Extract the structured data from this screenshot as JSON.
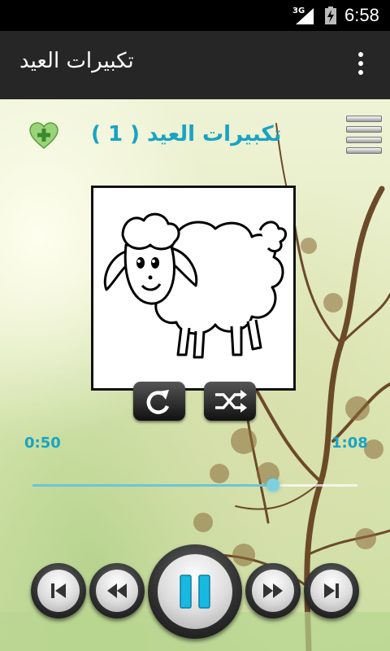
{
  "status_bar": {
    "network": "3G",
    "time": "6:58"
  },
  "action_bar": {
    "title": "تكبيرات العيد",
    "overflow_icon": "more-vert-icon"
  },
  "player": {
    "track_title": "تكبيرات العيد ( 1 )",
    "time_elapsed": "0:50",
    "time_total": "1:08",
    "progress_fraction": 0.74,
    "accent_color": "#19a3c3",
    "artwork": "sheep-drawing",
    "controls": [
      "skip-previous-icon",
      "rewind-icon",
      "pause-icon",
      "fast-forward-icon",
      "skip-next-icon",
      "repeat-icon",
      "shuffle-icon",
      "add-favorite-icon",
      "playlist-icon"
    ]
  }
}
